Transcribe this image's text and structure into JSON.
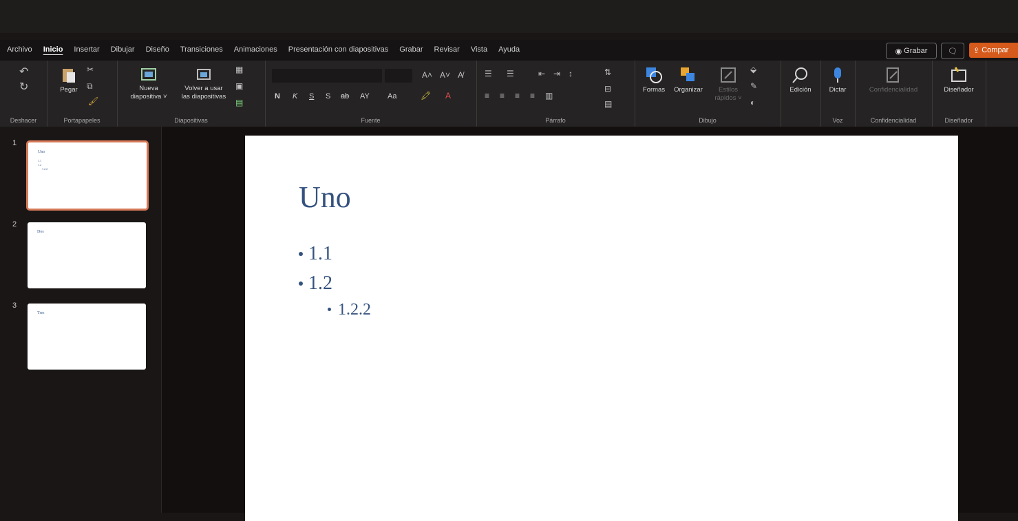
{
  "menu": {
    "tabs": [
      "Archivo",
      "Inicio",
      "Insertar",
      "Dibujar",
      "Diseño",
      "Transiciones",
      "Animaciones",
      "Presentación con diapositivas",
      "Grabar",
      "Revisar",
      "Vista",
      "Ayuda"
    ],
    "active_tab": "Inicio",
    "record_label": "Grabar",
    "share_label": "Compar"
  },
  "ribbon": {
    "groups": {
      "undo": "Deshacer",
      "clipboard": "Portapapeles",
      "slides": "Diapositivas",
      "font": "Fuente",
      "paragraph": "Párrafo",
      "drawing": "Dibujo",
      "voice": "Voz",
      "sensitivity": "Confidencialidad",
      "designer": "Diseñador"
    },
    "buttons": {
      "paste": "Pegar",
      "new_slide_l1": "Nueva",
      "new_slide_l2": "diapositiva ˅",
      "reuse_l1": "Volver a usar",
      "reuse_l2": "las diapositivas",
      "shapes": "Formas",
      "arrange": "Organizar",
      "quick_styles_l1": "Estilos",
      "quick_styles_l2": "rápidos ˅",
      "editing": "Edición",
      "dictate": "Dictar",
      "sensitivity": "Confidencialidad",
      "designer": "Diseñador"
    },
    "font_format": [
      "N",
      "K",
      "S",
      "S",
      "ab",
      "AY",
      "Aa"
    ]
  },
  "thumbnails": [
    {
      "number": "1",
      "title": "Uno"
    },
    {
      "number": "2",
      "title": "Dos"
    },
    {
      "number": "3",
      "title": "Tres"
    }
  ],
  "slide": {
    "title": "Uno",
    "bullets": [
      {
        "level": 1,
        "text": "1.1"
      },
      {
        "level": 1,
        "text": "1.2"
      },
      {
        "level": 2,
        "text": "1.2.2"
      }
    ]
  },
  "colors": {
    "accent": "#d55a1b",
    "title_text": "#35527f",
    "ribbon_bg": "#252323",
    "selection_border": "#d77a58"
  }
}
